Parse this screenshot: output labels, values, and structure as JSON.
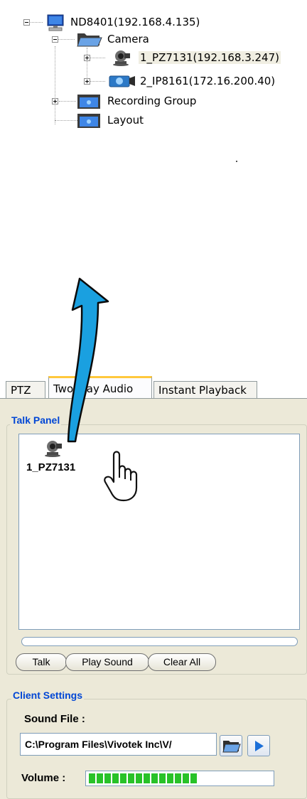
{
  "tree": {
    "root": {
      "label": "ND8401(192.168.4.135)"
    },
    "camera_folder": {
      "label": "Camera"
    },
    "cameras": [
      {
        "label": "1_PZ7131(192.168.3.247)",
        "selected": true
      },
      {
        "label": "2_IP8161(172.16.200.40)",
        "selected": false
      }
    ],
    "recording_group": {
      "label": "Recording Group"
    },
    "layout": {
      "label": "Layout"
    }
  },
  "tabs": [
    {
      "label": "PTZ",
      "active": false
    },
    {
      "label": "Two Way Audio",
      "active": true
    },
    {
      "label": "Instant Playback",
      "active": false
    }
  ],
  "talk_panel": {
    "title": "Talk Panel",
    "items": [
      {
        "label": "1_PZ7131"
      }
    ],
    "buttons": {
      "talk": "Talk",
      "play_sound": "Play Sound",
      "clear_all": "Clear All"
    }
  },
  "client_settings": {
    "title": "Client Settings",
    "sound_file_label": "Sound File :",
    "sound_file_value": "C:\\Program Files\\Vivotek Inc\\V/",
    "volume_label": "Volume :",
    "volume_level": 0.6
  },
  "colors": {
    "group_title": "#0046d5",
    "arrow": "#1aa0e0",
    "tab_highlight": "#ffc83c",
    "volume": "#28c228"
  },
  "icons": {
    "cursor": "hand-pointer-icon",
    "arrow": "curved-up-arrow-icon"
  }
}
